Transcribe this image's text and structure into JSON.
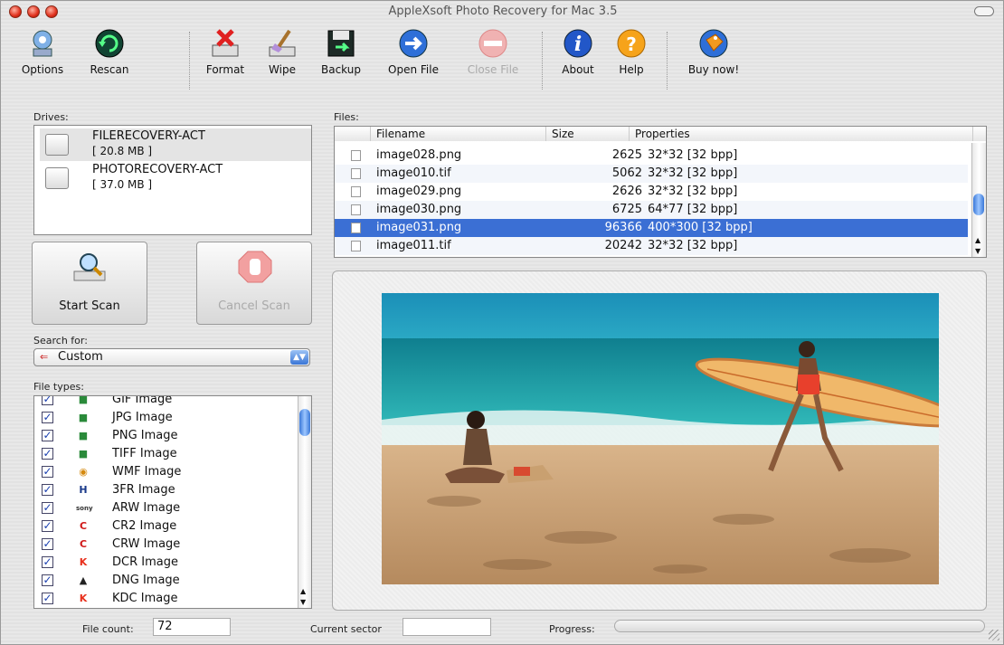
{
  "window": {
    "title": "AppleXsoft Photo Recovery for Mac 3.5"
  },
  "toolbar": [
    {
      "label": "Options",
      "icon": "options-icon",
      "enabled": true
    },
    {
      "label": "Rescan",
      "icon": "rescan-icon",
      "enabled": true
    },
    {
      "label": "Format",
      "icon": "format-icon",
      "enabled": true
    },
    {
      "label": "Wipe",
      "icon": "wipe-icon",
      "enabled": true
    },
    {
      "label": "Backup",
      "icon": "backup-icon",
      "enabled": true
    },
    {
      "label": "Open File",
      "icon": "open-file-icon",
      "enabled": true
    },
    {
      "label": "Close File",
      "icon": "close-file-icon",
      "enabled": false
    },
    {
      "label": "About",
      "icon": "about-icon",
      "enabled": true
    },
    {
      "label": "Help",
      "icon": "help-icon",
      "enabled": true
    },
    {
      "label": "Buy now!",
      "icon": "buy-now-icon",
      "enabled": true
    }
  ],
  "drives": {
    "label": "Drives:",
    "items": [
      {
        "name": "FILERECOVERY-ACT",
        "size": "[ 20.8 MB ]",
        "selected": true
      },
      {
        "name": "PHOTORECOVERY-ACT",
        "size": "[ 37.0 MB ]",
        "selected": false
      }
    ]
  },
  "scan": {
    "start_label": "Start Scan",
    "cancel_label": "Cancel Scan"
  },
  "search": {
    "label": "Search for:",
    "value": "Custom"
  },
  "file_types": {
    "label": "File types:",
    "items": [
      {
        "name": "GIF Image",
        "checked": true,
        "icon": "image-icon"
      },
      {
        "name": "JPG Image",
        "checked": true,
        "icon": "image-icon"
      },
      {
        "name": "PNG Image",
        "checked": true,
        "icon": "image-icon"
      },
      {
        "name": "TIFF Image",
        "checked": true,
        "icon": "image-icon"
      },
      {
        "name": "WMF Image",
        "checked": true,
        "icon": "wmf-icon"
      },
      {
        "name": "3FR Image",
        "checked": true,
        "icon": "hasselblad-icon"
      },
      {
        "name": "ARW Image",
        "checked": true,
        "icon": "sony-icon"
      },
      {
        "name": "CR2 Image",
        "checked": true,
        "icon": "canon-icon"
      },
      {
        "name": "CRW Image",
        "checked": true,
        "icon": "canon-icon"
      },
      {
        "name": "DCR Image",
        "checked": true,
        "icon": "kodak-icon"
      },
      {
        "name": "DNG Image",
        "checked": true,
        "icon": "dng-icon"
      },
      {
        "name": "KDC Image",
        "checked": true,
        "icon": "kodak-icon"
      }
    ]
  },
  "files": {
    "label": "Files:",
    "columns": [
      "Filename",
      "Size",
      "Properties"
    ],
    "rows": [
      {
        "name": "image028.png",
        "size": "2625",
        "props": "32*32 [32 bpp]",
        "selected": false
      },
      {
        "name": "image010.tif",
        "size": "5062",
        "props": "32*32 [32 bpp]",
        "selected": false
      },
      {
        "name": "image029.png",
        "size": "2626",
        "props": "32*32 [32 bpp]",
        "selected": false
      },
      {
        "name": "image030.png",
        "size": "6725",
        "props": "64*77 [32 bpp]",
        "selected": false
      },
      {
        "name": "image031.png",
        "size": "96366",
        "props": "400*300 [32 bpp]",
        "selected": true
      },
      {
        "name": "image011.tif",
        "size": "20242",
        "props": "32*32 [32 bpp]",
        "selected": false
      }
    ]
  },
  "status": {
    "file_count_label": "File count:",
    "file_count": "72",
    "sector_label": "Current sector",
    "sector_value": "",
    "progress_label": "Progress:",
    "progress": 0
  },
  "colors": {
    "selection": "#3b6fd4",
    "accent": "#3a78d8"
  }
}
